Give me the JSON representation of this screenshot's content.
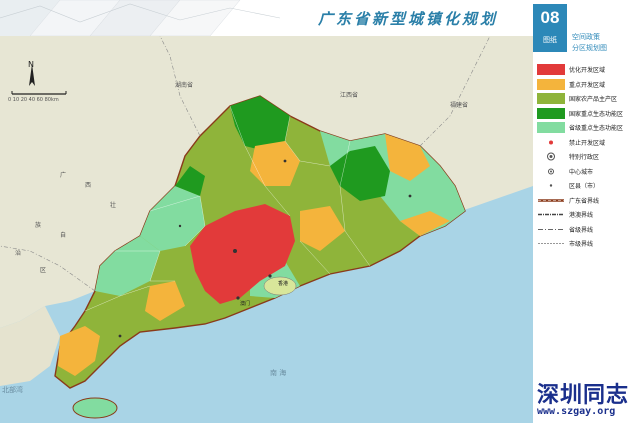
{
  "header": {
    "title": "广东省新型城镇化规划",
    "page_number": "08",
    "badge_caption": "图纸",
    "section": "空间政策",
    "map_name": "分区规划图"
  },
  "compass": {
    "north": "N",
    "scale": "0  10  20  40  60  80km"
  },
  "map_labels": {
    "hunan": "湖南省",
    "jiangxi": "江西省",
    "fujian": "福建省",
    "guangxi_1": "广",
    "guangxi_2": "西",
    "guangxi_3": "壮",
    "guangxi_4": "族",
    "guangxi_5": "自",
    "guangxi_6": "治",
    "guangxi_7": "区",
    "south_sea": "南  海",
    "beibu": "北部湾",
    "hk": "香港",
    "macau": "澳门"
  },
  "legend": [
    {
      "label": "优化开发区域",
      "color": "#e23a3a",
      "kind": "fill"
    },
    {
      "label": "重点开发区域",
      "color": "#f4b43c",
      "kind": "fill"
    },
    {
      "label": "国家农产品主产区",
      "color": "#8fb43a",
      "kind": "fill"
    },
    {
      "label": "国家重点生态功能区",
      "color": "#1f9a1f",
      "kind": "fill"
    },
    {
      "label": "省级重点生态功能区",
      "color": "#82dca0",
      "kind": "fill"
    },
    {
      "label": "禁止开发区域",
      "color": "#e23a3a",
      "kind": "dot"
    },
    {
      "label": "特别行政区",
      "color": "#555555",
      "kind": "ring"
    },
    {
      "label": "中心城市",
      "color": "#555555",
      "kind": "ring-small"
    },
    {
      "label": "区县（市）",
      "color": "#555555",
      "kind": "dot-small"
    },
    {
      "label": "广东省界线",
      "color": "#8a3a1a",
      "kind": "line-thick"
    },
    {
      "label": "港澳界线",
      "color": "#444444",
      "kind": "line-dash"
    },
    {
      "label": "省级界线",
      "color": "#666666",
      "kind": "line-dashdot"
    },
    {
      "label": "市级界线",
      "color": "#777777",
      "kind": "line-thin"
    }
  ],
  "watermark": {
    "text": "深圳同志",
    "url": "www.szgay.org"
  }
}
